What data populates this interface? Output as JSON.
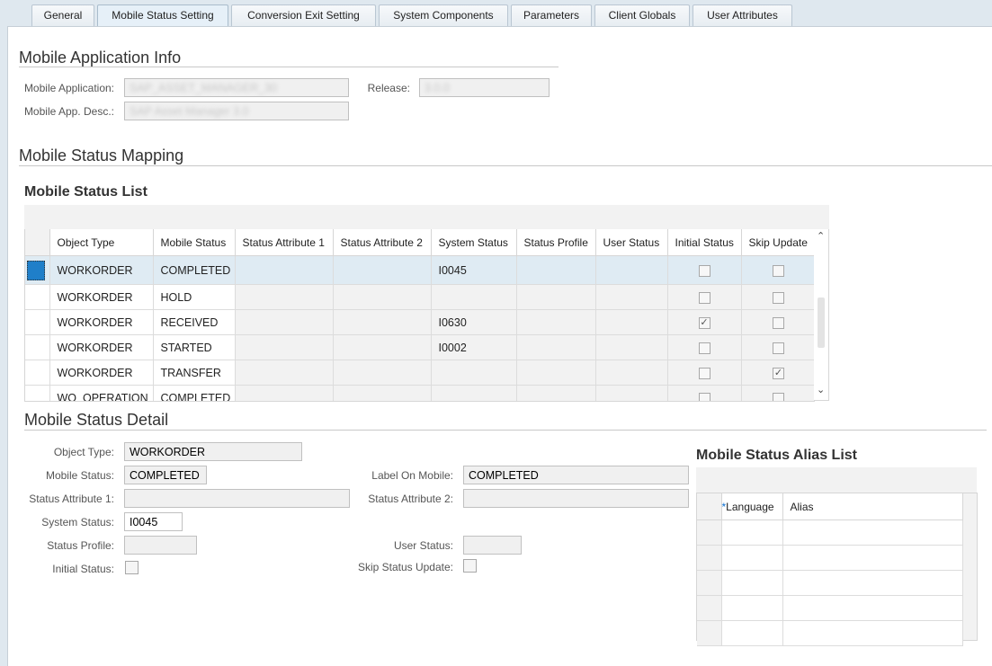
{
  "tabs": [
    {
      "label": "General"
    },
    {
      "label": "Mobile Status Setting"
    },
    {
      "label": "Conversion Exit Setting"
    },
    {
      "label": "System Components"
    },
    {
      "label": "Parameters"
    },
    {
      "label": "Client Globals"
    },
    {
      "label": "User Attributes"
    }
  ],
  "app_info": {
    "title": "Mobile Application Info",
    "mobile_application_label": "Mobile Application:",
    "mobile_application_value": "SAP_ASSET_MANAGER_30",
    "release_label": "Release:",
    "release_value": "3.0.0",
    "app_desc_label": "Mobile App. Desc.:",
    "app_desc_value": "SAP Asset Manager 3.0"
  },
  "mapping": {
    "title": "Mobile Status Mapping",
    "list_title": "Mobile Status List",
    "columns": [
      "Object Type",
      "Mobile Status",
      "Status Attribute 1",
      "Status Attribute 2",
      "System Status",
      "Status Profile",
      "User Status",
      "Initial Status",
      "Skip Update"
    ],
    "rows": [
      {
        "object_type": "WORKORDER",
        "mobile_status": "COMPLETED",
        "attr1": "",
        "attr2": "",
        "system_status": "I0045",
        "profile": "",
        "user_status": "",
        "initial": false,
        "skip": false
      },
      {
        "object_type": "WORKORDER",
        "mobile_status": "HOLD",
        "attr1": "",
        "attr2": "",
        "system_status": "",
        "profile": "",
        "user_status": "",
        "initial": false,
        "skip": false
      },
      {
        "object_type": "WORKORDER",
        "mobile_status": "RECEIVED",
        "attr1": "",
        "attr2": "",
        "system_status": "I0630",
        "profile": "",
        "user_status": "",
        "initial": true,
        "skip": false
      },
      {
        "object_type": "WORKORDER",
        "mobile_status": "STARTED",
        "attr1": "",
        "attr2": "",
        "system_status": "I0002",
        "profile": "",
        "user_status": "",
        "initial": false,
        "skip": false
      },
      {
        "object_type": "WORKORDER",
        "mobile_status": "TRANSFER",
        "attr1": "",
        "attr2": "",
        "system_status": "",
        "profile": "",
        "user_status": "",
        "initial": false,
        "skip": true
      },
      {
        "object_type": "WO_OPERATION",
        "mobile_status": "COMPLETED",
        "attr1": "",
        "attr2": "",
        "system_status": "",
        "profile": "",
        "user_status": "",
        "initial": false,
        "skip": false
      }
    ]
  },
  "detail": {
    "title": "Mobile Status Detail",
    "object_type_label": "Object Type:",
    "object_type_value": "WORKORDER",
    "mobile_status_label": "Mobile Status:",
    "mobile_status_value": "COMPLETED",
    "label_on_mobile_label": "Label On Mobile:",
    "label_on_mobile_value": "COMPLETED",
    "status_attr1_label": "Status Attribute 1:",
    "status_attr1_value": "",
    "status_attr2_label": "Status Attribute 2:",
    "status_attr2_value": "",
    "system_status_label": "System Status:",
    "system_status_value": "I0045",
    "status_profile_label": "Status Profile:",
    "status_profile_value": "",
    "user_status_label": "User Status:",
    "user_status_value": "",
    "initial_status_label": "Initial Status:",
    "skip_status_update_label": "Skip Status Update:"
  },
  "alias": {
    "title": "Mobile Status Alias List",
    "required_mark": "*",
    "language_header": "Language",
    "alias_header": "Alias"
  }
}
